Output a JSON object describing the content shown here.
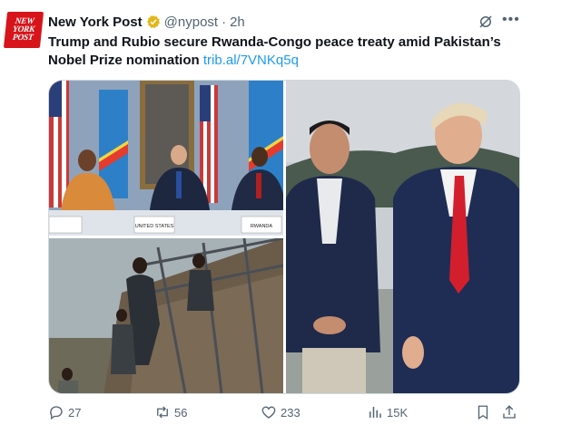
{
  "tweet": {
    "avatar_text": [
      "NEW",
      "YORK",
      "POST"
    ],
    "author_name": "New York Post",
    "handle": "@nypost",
    "separator": "·",
    "time": "2h",
    "text": "Trump and Rubio secure Rwanda-Congo peace treaty amid Pakistan’s Nobel Prize nomination",
    "link": "trib.al/7VNKq5q",
    "media": {
      "photo1_labels": [
        "UNITED STATES",
        "RWANDA"
      ]
    }
  },
  "actions": {
    "replies": "27",
    "reposts": "56",
    "likes": "233",
    "views": "15K"
  },
  "colors": {
    "accent": "#1d9bf0",
    "brand_red": "#d7141a",
    "verified_gold": "#e2b719",
    "muted_text": "#536471"
  },
  "icons": [
    "verified-badge-icon",
    "grok-icon",
    "more-icon",
    "reply-icon",
    "repost-icon",
    "like-icon",
    "views-icon",
    "bookmark-icon",
    "share-icon"
  ]
}
